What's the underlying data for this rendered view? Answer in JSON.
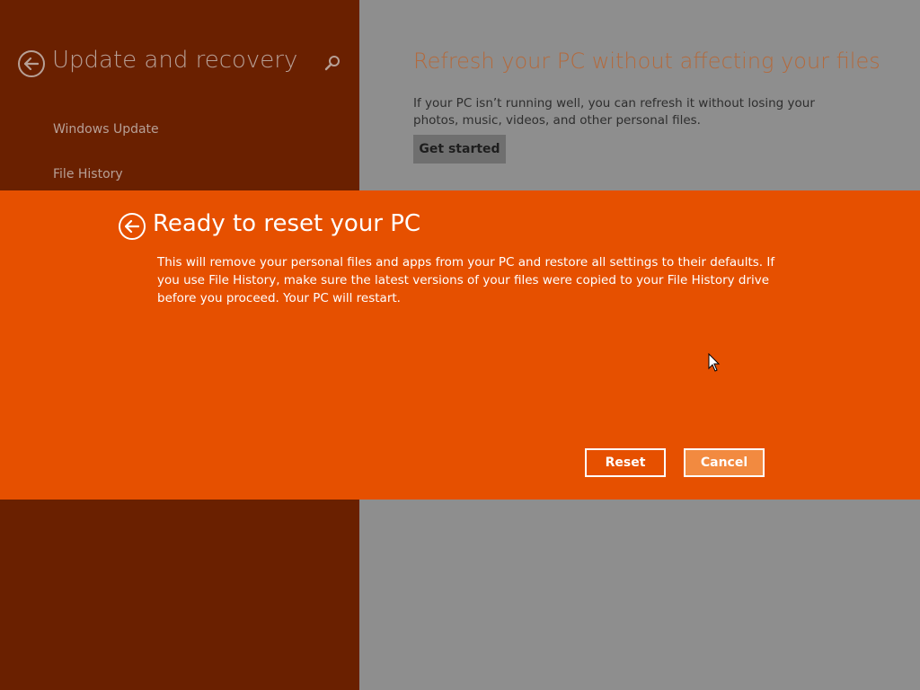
{
  "sidebar": {
    "title": "Update and recovery",
    "back_icon": "back-arrow-icon",
    "search_icon": "search-icon",
    "items": [
      {
        "label": "Windows Update"
      },
      {
        "label": "File History"
      }
    ]
  },
  "main": {
    "refresh": {
      "title": "Refresh your PC without affecting your files",
      "description": "If your PC isn’t running well, you can refresh it without losing your photos, music, videos, and other personal files.",
      "button_label": "Get started"
    }
  },
  "dialog": {
    "title": "Ready to reset your PC",
    "body": "This will remove your personal files and apps from your PC and restore all settings to their defaults. If you use File History, make sure the latest versions of your files were copied to your File History drive before you proceed. Your PC will restart.",
    "reset_label": "Reset",
    "cancel_label": "Cancel",
    "back_icon": "back-arrow-icon"
  },
  "colors": {
    "sidebar_bg": "#6a2000",
    "content_bg": "#8e8e8e",
    "dialog_bg": "#e65000",
    "accent_button": "#f28a40"
  }
}
